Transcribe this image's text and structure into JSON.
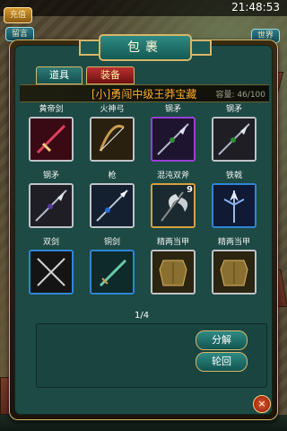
{
  "status_bar": {
    "time": "21:48:53"
  },
  "top_left": {
    "recharge_label": "充值",
    "stay_label": "留言"
  },
  "top_right": {
    "world_label": "世界",
    "help_symbol": "?"
  },
  "panel": {
    "title": "包裹",
    "tabs": [
      {
        "label": "道具",
        "active": false
      },
      {
        "label": "装备",
        "active": true
      }
    ],
    "selected_item_name": "[小]勇闯中级王莽宝藏",
    "capacity_text": "容量: 46/100",
    "page_indicator": "1/4",
    "buttons": {
      "decompose": "分解",
      "reincarnate": "轮回"
    },
    "close_symbol": "×"
  },
  "items": [
    {
      "name": "黄帝剑",
      "frame": "silver",
      "icon": "sword-icon"
    },
    {
      "name": "火神弓",
      "frame": "silver",
      "icon": "bow-icon"
    },
    {
      "name": "钢矛",
      "frame": "purple",
      "icon": "spear-icon"
    },
    {
      "name": "钢矛",
      "frame": "silver",
      "icon": "spear-icon"
    },
    {
      "name": "钢矛",
      "frame": "silver",
      "icon": "spear-icon"
    },
    {
      "name": "枪",
      "frame": "silver",
      "icon": "lance-icon"
    },
    {
      "name": "混沌双斧",
      "frame": "gold",
      "icon": "double-axe-icon",
      "count": "9"
    },
    {
      "name": "铁戟",
      "frame": "blue",
      "icon": "halberd-icon"
    },
    {
      "name": "双剑",
      "frame": "blue",
      "icon": "twin-swords-icon"
    },
    {
      "name": "铜剑",
      "frame": "blue",
      "icon": "bronze-sword-icon"
    },
    {
      "name": "精两当甲",
      "frame": "silver",
      "icon": "armor-icon"
    },
    {
      "name": "精两当甲",
      "frame": "silver",
      "icon": "armor-icon"
    }
  ]
}
